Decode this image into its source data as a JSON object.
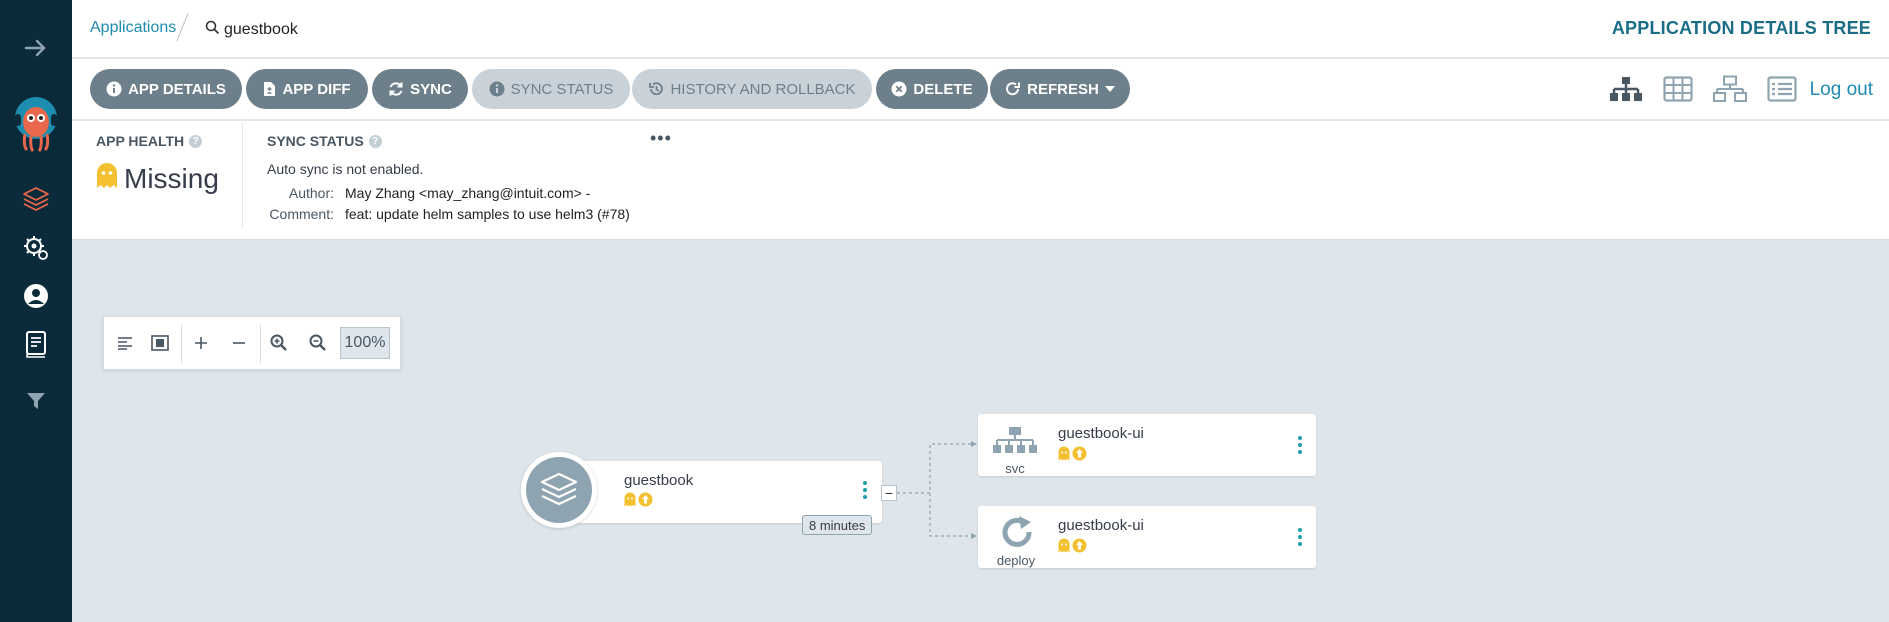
{
  "breadcrumb": {
    "root_label": "Applications",
    "current_label": "guestbook"
  },
  "page_title": "APPLICATION DETAILS TREE",
  "toolbar": {
    "buttons": [
      {
        "label": "APP DETAILS",
        "icon": "info-circle-icon",
        "disabled": false
      },
      {
        "label": "APP DIFF",
        "icon": "file-diff-icon",
        "disabled": false
      },
      {
        "label": "SYNC",
        "icon": "sync-icon",
        "disabled": false
      },
      {
        "label": "SYNC STATUS",
        "icon": "info-circle-icon",
        "disabled": true
      },
      {
        "label": "HISTORY AND ROLLBACK",
        "icon": "history-icon",
        "disabled": true
      },
      {
        "label": "DELETE",
        "icon": "times-circle-icon",
        "disabled": false
      },
      {
        "label": "REFRESH",
        "icon": "redo-icon",
        "disabled": false
      }
    ],
    "view_icons": [
      "tree-view-icon",
      "pods-view-icon",
      "network-view-icon",
      "list-view-icon"
    ],
    "logout_label": "Log out"
  },
  "sidebar": {
    "items": [
      "expand-arrow-icon",
      "argo-logo",
      "applications-icon",
      "settings-icon",
      "user-icon",
      "docs-icon",
      "filter-icon"
    ]
  },
  "status": {
    "health_label": "APP HEALTH",
    "health_value": "Missing",
    "sync_label": "SYNC STATUS",
    "sync_note": "Auto sync is not enabled.",
    "author_key": "Author:",
    "author_value": "May Zhang <may_zhang@intuit.com> -",
    "comment_key": "Comment:",
    "comment_value": "feat: update helm samples to use helm3 (#78)"
  },
  "zoom": {
    "percent": "100%"
  },
  "graph": {
    "app_node": {
      "name": "guestbook",
      "age": "8 minutes"
    },
    "resources": [
      {
        "name": "guestbook-ui",
        "kind": "svc"
      },
      {
        "name": "guestbook-ui",
        "kind": "deploy"
      }
    ]
  },
  "colors": {
    "sidebar_bg": "#0c2b3a",
    "accent": "#1f8bb0",
    "button_bg": "#6d7f8b",
    "missing_yellow": "#f4c030",
    "canvas_bg": "#dee6eb"
  }
}
